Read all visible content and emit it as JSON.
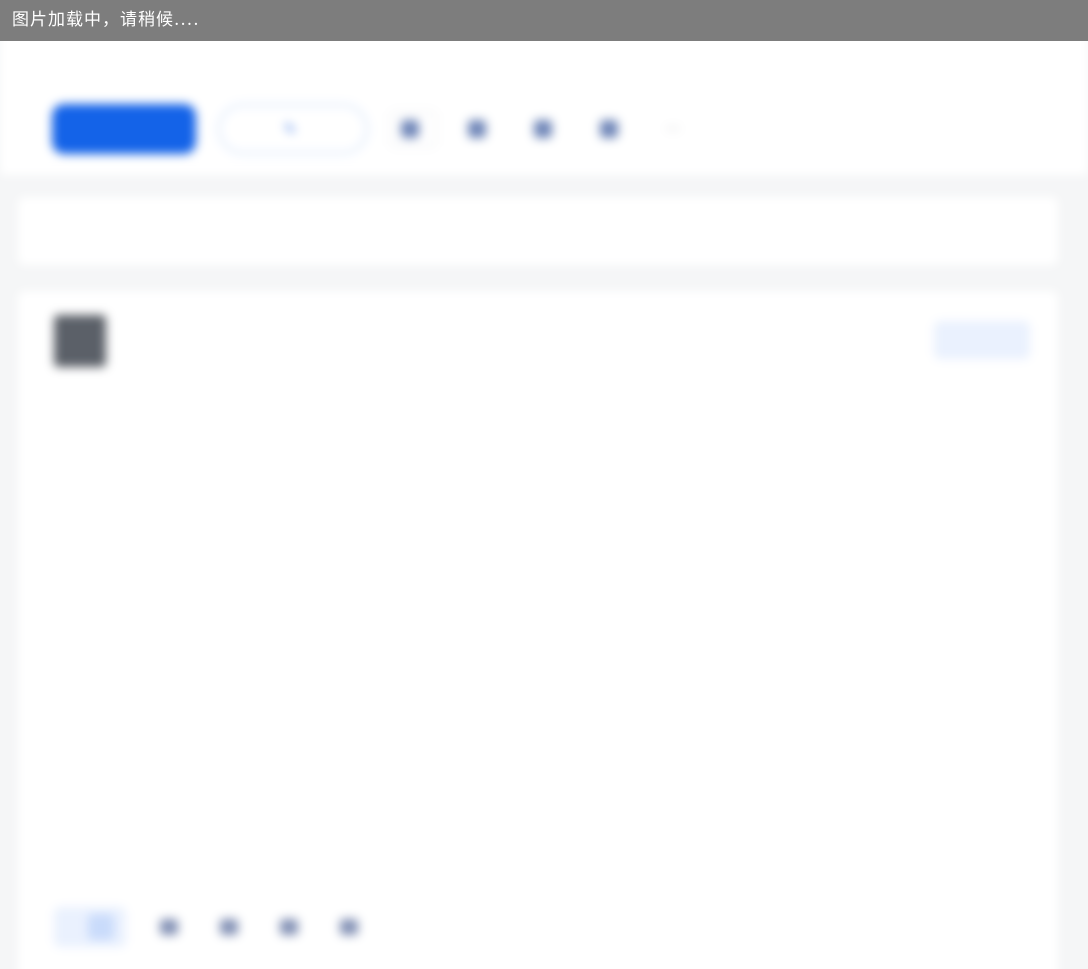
{
  "loading": {
    "text": "图片加载中，请稍候...."
  },
  "header": {
    "title_line": "",
    "subtitle_line": ""
  },
  "actions": {
    "primary_label": "",
    "invite_label": "",
    "ghost_items": [
      "",
      "",
      "",
      "",
      "",
      ""
    ]
  },
  "follow_card": {
    "label": ""
  },
  "answer": {
    "username": "",
    "user_desc": "",
    "follow_label": "",
    "tag_line": "",
    "paragraphs": [
      "",
      "",
      "",
      "",
      "",
      ""
    ],
    "meta": "",
    "vote_label": "",
    "bottom_items": [
      "",
      "",
      "",
      ""
    ]
  },
  "colors": {
    "primary": "#1463e8",
    "overlay": "#7d7d7d",
    "link": "#3f7be8"
  }
}
